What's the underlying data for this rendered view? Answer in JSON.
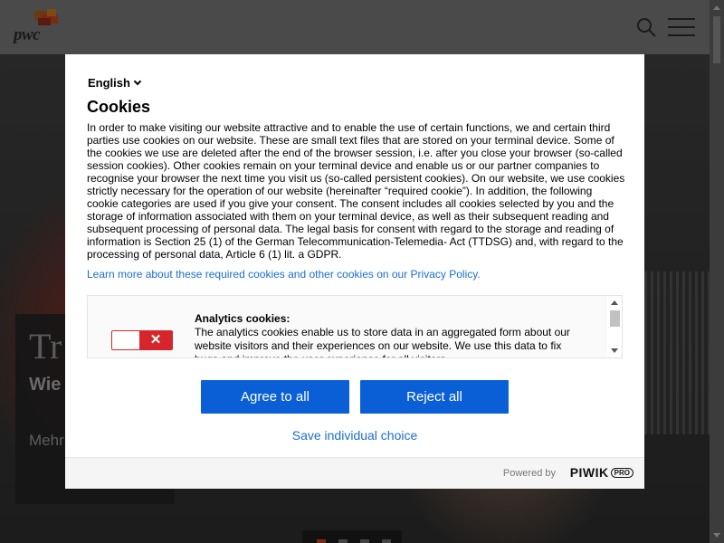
{
  "site": {
    "logo_text": "pwc",
    "hero": {
      "title": "Tr",
      "subtitle": "Wie helfe",
      "more_label": "Mehr erfahren"
    }
  },
  "dialog": {
    "language": "English",
    "title": "Cookies",
    "body": "In order to make visiting our website attractive and to enable the use of certain functions, we and certain third parties use cookies on our website. These are small text files that are stored on your terminal device. Some of the cookies we use are deleted after the end of the browser session, i.e. after you close your browser (so-called session cookies). Other cookies remain on your terminal device and enable us or our partner companies to recognise your browser the next time you visit us (so-called persistent cookies). On our website, we use cookies strictly necessary for the operation of our website (hereinafter “required cookie”). In addition, the following cookie categories are used if you give your consent. The consent includes all cookies selected by you and the storage of information associated with them on your terminal device, as well as their subsequent reading and subsequent processing of personal data. The legal basis for consent with regard to the storage and reading of information is Section 25 (1) of the German Telecommunication-Telemedia- Act (TTDSG) and, with regard to the processing of personal data, Article 6 (1) lit. a GDPR.",
    "learn_more_link": "Learn more about these required cookies and other cookies on our Privacy Policy.",
    "consent": {
      "title": "Analytics cookies:",
      "text": "The analytics cookies enable us to store data in an aggregated form about our website visitors and their experiences on our website. We use this data to fix bugs and improve the user experience for all visitors.",
      "toggle_state": "off",
      "toggle_icon": "close-icon"
    },
    "agree_label": "Agree to all",
    "reject_label": "Reject all",
    "save_label": "Save individual choice",
    "footer": {
      "powered_by": "Powered by",
      "brand": "PIWIK",
      "brand_badge": "PRO"
    }
  },
  "colors": {
    "primary_button": "#0a5fd6",
    "link": "#1a6ecf",
    "toggle_off": "#d6262b",
    "overlay": "#2a2a2a"
  }
}
